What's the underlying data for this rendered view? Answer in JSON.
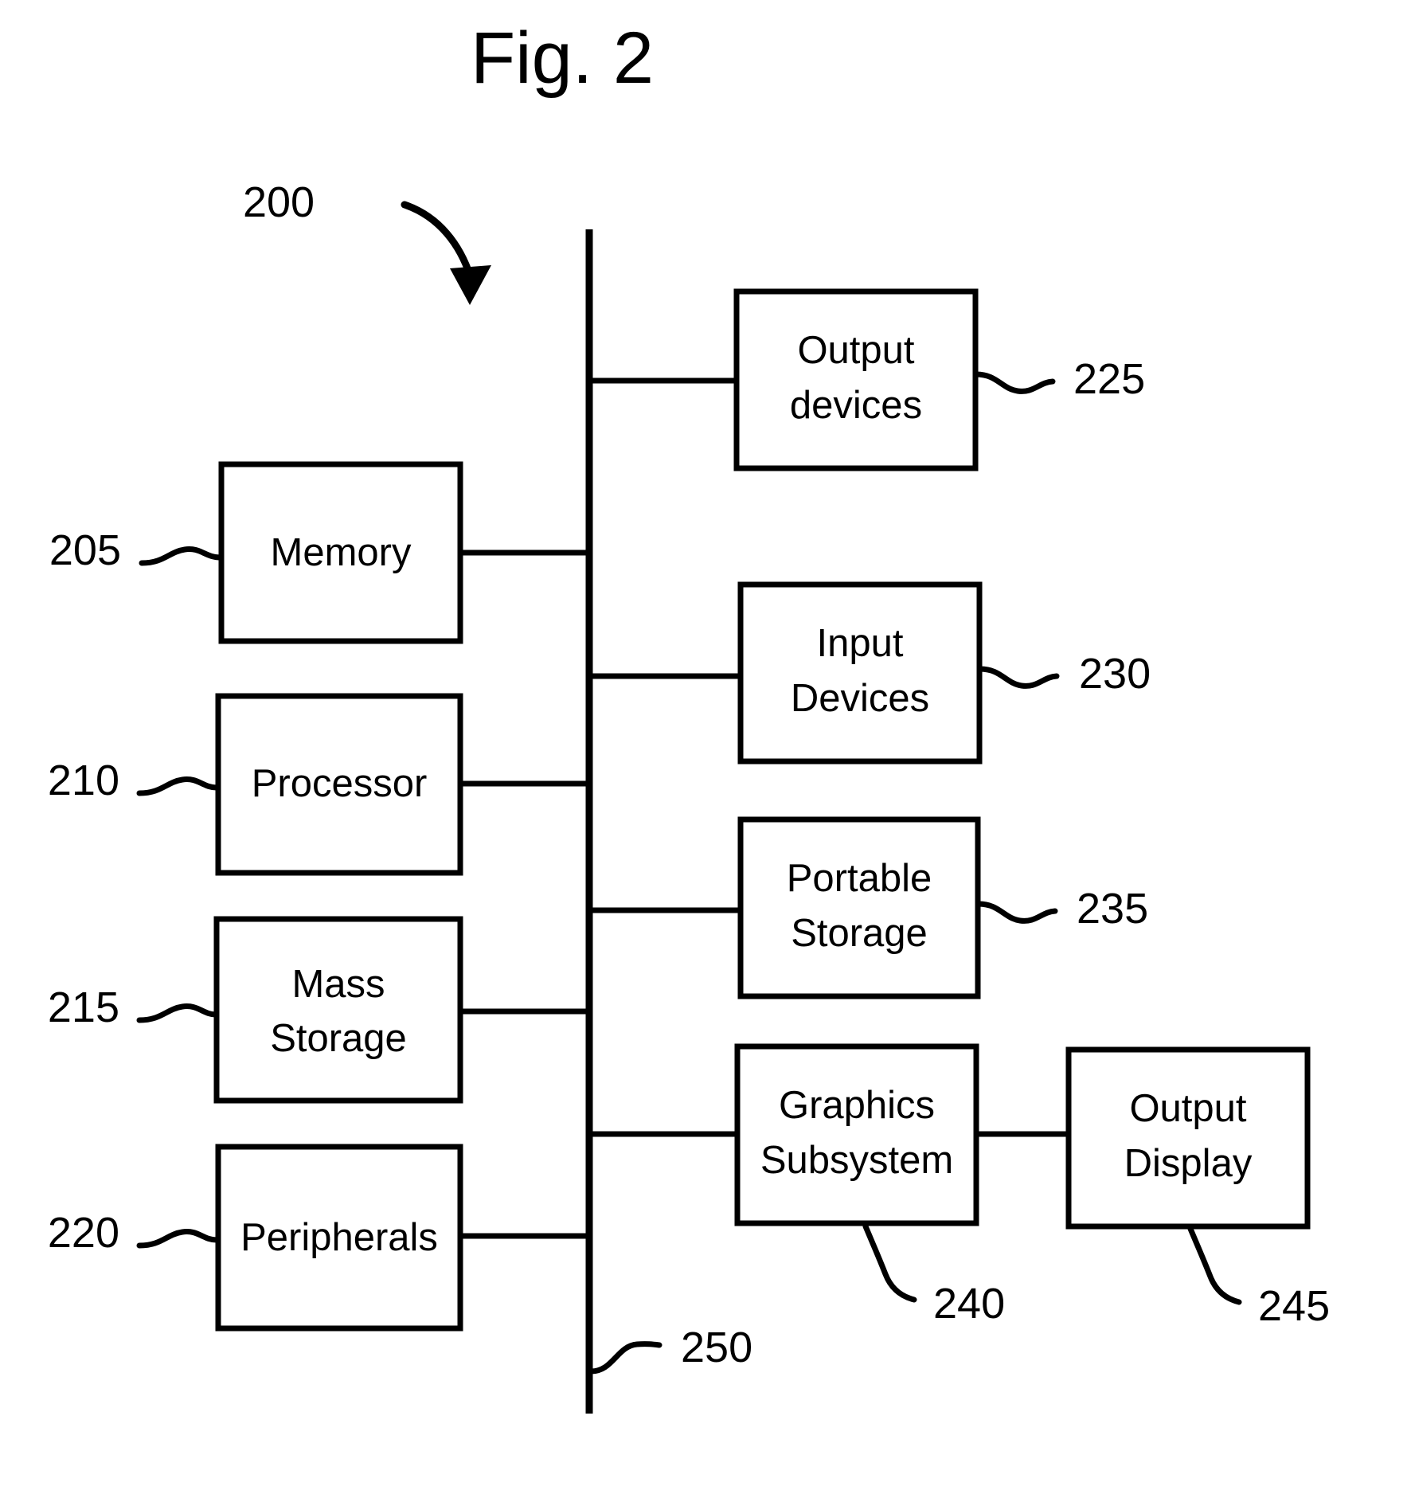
{
  "figure": {
    "title": "Fig. 2",
    "system_ref": "200",
    "bus_ref": "250"
  },
  "boxes": {
    "memory": {
      "label": "Memory",
      "ref": "205"
    },
    "processor": {
      "label": "Processor",
      "ref": "210"
    },
    "mass_storage": {
      "label_line1": "Mass",
      "label_line2": "Storage",
      "ref": "215"
    },
    "peripherals": {
      "label": "Peripherals",
      "ref": "220"
    },
    "output_devices": {
      "label_line1": "Output",
      "label_line2": "devices",
      "ref": "225"
    },
    "input_devices": {
      "label_line1": "Input",
      "label_line2": "Devices",
      "ref": "230"
    },
    "portable_storage": {
      "label_line1": "Portable",
      "label_line2": "Storage",
      "ref": "235"
    },
    "graphics_subsystem": {
      "label_line1": "Graphics",
      "label_line2": "Subsystem",
      "ref": "240"
    },
    "output_display": {
      "label_line1": "Output",
      "label_line2": "Display",
      "ref": "245"
    }
  },
  "colors": {
    "ink": "#000000",
    "paper": "#ffffff"
  }
}
